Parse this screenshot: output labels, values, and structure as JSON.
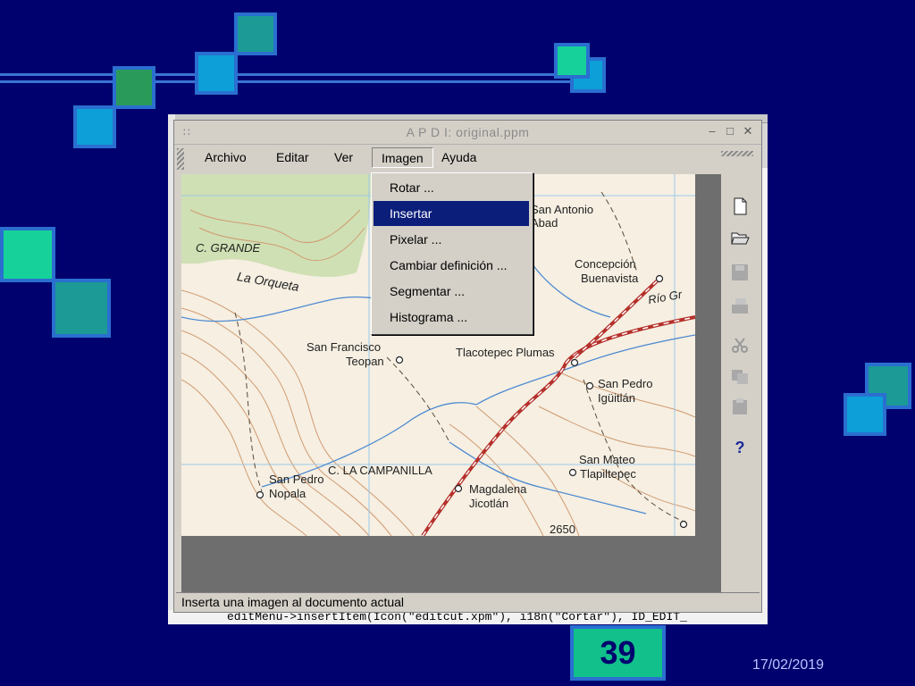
{
  "window": {
    "title": "A P D I: original.ppm",
    "controls": {
      "minimize": "–",
      "maximize": "□",
      "close": "✕"
    }
  },
  "menubar": {
    "items": [
      "Archivo",
      "Editar",
      "Ver",
      "Imagen",
      "Ayuda"
    ],
    "active": "Imagen"
  },
  "dropdown": {
    "items": [
      "Rotar ...",
      "Insertar",
      "Pixelar ...",
      "Cambiar definición ...",
      "Segmentar ...",
      "Histograma ..."
    ],
    "highlighted": "Insertar"
  },
  "map": {
    "labels": [
      "C. GRANDE",
      "La Orqueta",
      "San Antonio",
      "Abad",
      "Concepción",
      "Buenavista",
      "Río Gr",
      "San Francisco",
      "Teopan",
      "Tlacotepec Plumas",
      "San Pedro",
      "Igüitlán",
      "San Mateo",
      "Tlapiltepec",
      "San Pedro",
      "Nopala",
      "C. LA CAMPANILLA",
      "Magdalena",
      "Jicotlán",
      "2650"
    ]
  },
  "toolbar": {
    "tools": [
      "new-document-icon",
      "open-folder-icon",
      "save-icon",
      "print-icon",
      "cut-icon",
      "copy-icon",
      "paste-icon",
      "help-icon"
    ],
    "help_label": "?"
  },
  "statusbar": {
    "text": "Inserta una imagen al documento actual"
  },
  "background_code": "editMenu->insertItem(Icon(\"editcut.xpm\"), i18n(\"Cortar\"), ID_EDIT_",
  "slide": {
    "page_number": "39",
    "date": "17/02/2019"
  },
  "colors": {
    "slide_bg": "#00006e",
    "highlight": "#0a1e7a",
    "page_box": "#11c08a"
  }
}
